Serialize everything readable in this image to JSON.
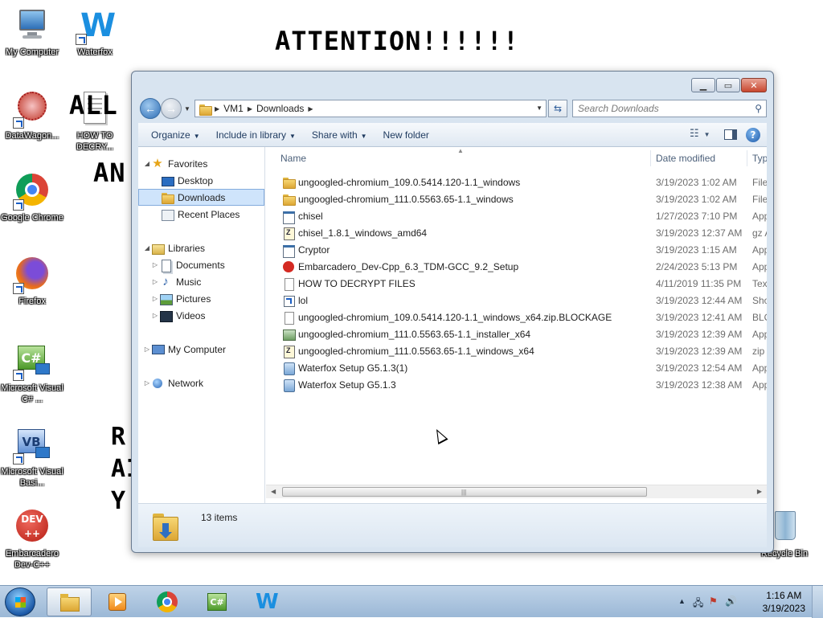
{
  "desktop": {
    "ransom_title": "ATTENTION!!!!!!",
    "ransom_fragments": [
      "ALL Y",
      "AN",
      "R",
      "AI",
      "Y"
    ],
    "icons": [
      {
        "label": "My Computer",
        "icon": "computer-icon"
      },
      {
        "label": "Waterfox",
        "icon": "waterfox-icon"
      },
      {
        "label": "DataWagon...",
        "icon": "datawagon-icon"
      },
      {
        "label": "HOW TO DECRY...",
        "icon": "text-document-icon"
      },
      {
        "label": "Google Chrome",
        "icon": "chrome-icon"
      },
      {
        "label": "Firefox",
        "icon": "firefox-icon"
      },
      {
        "label": "Microsoft Visual C# ...",
        "icon": "visual-csharp-icon"
      },
      {
        "label": "Microsoft Visual Basi...",
        "icon": "visual-basic-icon"
      },
      {
        "label": "Embarcadero Dev-C++",
        "icon": "devcpp-icon"
      },
      {
        "label": "Recycle Bin",
        "icon": "recycle-bin-icon"
      }
    ]
  },
  "explorer": {
    "breadcrumb": [
      "VM1",
      "Downloads"
    ],
    "search_placeholder": "Search Downloads",
    "toolbar": {
      "organize": "Organize",
      "include_in_library": "Include in library",
      "share_with": "Share with",
      "new_folder": "New folder"
    },
    "nav": {
      "favorites": "Favorites",
      "desktop": "Desktop",
      "downloads": "Downloads",
      "recent_places": "Recent Places",
      "libraries": "Libraries",
      "documents": "Documents",
      "music": "Music",
      "pictures": "Pictures",
      "videos": "Videos",
      "my_computer": "My Computer",
      "network": "Network"
    },
    "columns": {
      "name": "Name",
      "date_modified": "Date modified",
      "type": "Typ"
    },
    "files": [
      {
        "name": "ungoogled-chromium_109.0.5414.120-1.1_windows",
        "date": "3/19/2023 1:02 AM",
        "type": "File",
        "icon": "folder-icon"
      },
      {
        "name": "ungoogled-chromium_111.0.5563.65-1.1_windows",
        "date": "3/19/2023 1:02 AM",
        "type": "File",
        "icon": "folder-icon"
      },
      {
        "name": "chisel",
        "date": "1/27/2023 7:10 PM",
        "type": "App",
        "icon": "application-icon"
      },
      {
        "name": "chisel_1.8.1_windows_amd64",
        "date": "3/19/2023 12:37 AM",
        "type": "gz A",
        "icon": "archive-icon"
      },
      {
        "name": "Cryptor",
        "date": "3/19/2023 1:15 AM",
        "type": "App",
        "icon": "application-icon"
      },
      {
        "name": "Embarcadero_Dev-Cpp_6.3_TDM-GCC_9.2_Setup",
        "date": "2/24/2023 5:13 PM",
        "type": "App",
        "icon": "devcpp-setup-icon"
      },
      {
        "name": "HOW TO DECRYPT FILES",
        "date": "4/11/2019 11:35 PM",
        "type": "Text",
        "icon": "text-document-icon"
      },
      {
        "name": "lol",
        "date": "3/19/2023 12:44 AM",
        "type": "Sho",
        "icon": "shortcut-icon"
      },
      {
        "name": "ungoogled-chromium_109.0.5414.120-1.1_windows_x64.zip.BLOCKAGE",
        "date": "3/19/2023 12:41 AM",
        "type": "BLO",
        "icon": "blank-file-icon"
      },
      {
        "name": "ungoogled-chromium_111.0.5563.65-1.1_installer_x64",
        "date": "3/19/2023 12:39 AM",
        "type": "App",
        "icon": "installer-icon"
      },
      {
        "name": "ungoogled-chromium_111.0.5563.65-1.1_windows_x64",
        "date": "3/19/2023 12:39 AM",
        "type": "zip A",
        "icon": "zip-icon"
      },
      {
        "name": "Waterfox Setup G5.1.3(1)",
        "date": "3/19/2023 12:54 AM",
        "type": "App",
        "icon": "setup-icon"
      },
      {
        "name": "Waterfox Setup G5.1.3",
        "date": "3/19/2023 12:38 AM",
        "type": "App",
        "icon": "setup-icon"
      }
    ],
    "item_count": "13 items"
  },
  "taskbar": {
    "clock_time": "1:16 AM",
    "clock_date": "3/19/2023",
    "apps": [
      "explorer-icon",
      "media-player-icon",
      "chrome-icon",
      "visual-csharp-icon",
      "waterfox-icon"
    ]
  },
  "colors": {
    "accent": "#1d5aa8",
    "selection": "#cfe4fb",
    "taskbar": "#9bb8d6"
  }
}
